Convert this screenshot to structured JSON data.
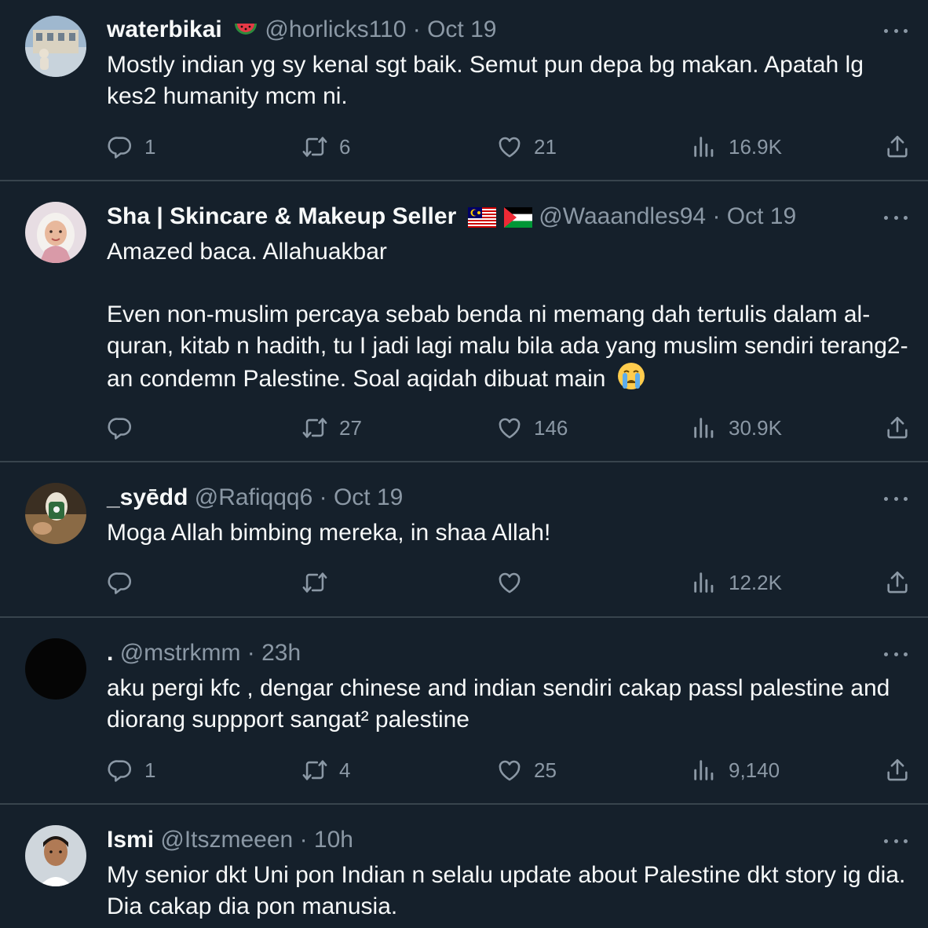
{
  "tweets": [
    {
      "name": "waterbikai",
      "handle": "@horlicks110",
      "sep": "·",
      "time": "Oct 19",
      "text": "Mostly indian yg sy kenal sgt baik. Semut pun depa bg makan. Apatah lg kes2 humanity mcm ni.",
      "replies": "1",
      "retweets": "6",
      "likes": "21",
      "views": "16.9K",
      "name_emoji": "watermelon-icon"
    },
    {
      "name": "Sha | Skincare & Makeup Seller",
      "handle": "@Waaandles94",
      "sep": "·",
      "time": "Oct 19",
      "text_1": "Amazed baca. Allahuakbar",
      "text_2": "Even non-muslim percaya sebab benda ni memang dah tertulis dalam al-quran, kitab n hadith, tu I jadi lagi malu bila ada yang muslim sendiri terang2-an condemn Palestine. Soal aqidah dibuat main",
      "replies": "",
      "retweets": "27",
      "likes": "146",
      "views": "30.9K",
      "name_emoji": "malaysia-flag-icon palestine-flag-icon"
    },
    {
      "name": "_syēdd",
      "handle": "@Rafiqqq6",
      "sep": "·",
      "time": "Oct 19",
      "text": "Moga Allah bimbing mereka, in shaa Allah!",
      "replies": "",
      "retweets": "",
      "likes": "",
      "views": "12.2K"
    },
    {
      "name": ".",
      "handle": "@mstrkmm",
      "sep": "·",
      "time": "23h",
      "text": "aku pergi kfc , dengar chinese and indian sendiri cakap passl palestine and diorang suppport sangat² palestine",
      "replies": "1",
      "retweets": "4",
      "likes": "25",
      "views": "9,140"
    },
    {
      "name": "Ismi",
      "handle": "@Itszmeeen",
      "sep": "·",
      "time": "10h",
      "text": "My senior dkt Uni pon Indian n selalu update about Palestine dkt story ig dia. Dia cakap dia pon manusia."
    }
  ],
  "colors": {
    "background": "#15202b",
    "text": "#f7f9f9",
    "muted": "#8b98a5",
    "divider": "#38444d"
  }
}
